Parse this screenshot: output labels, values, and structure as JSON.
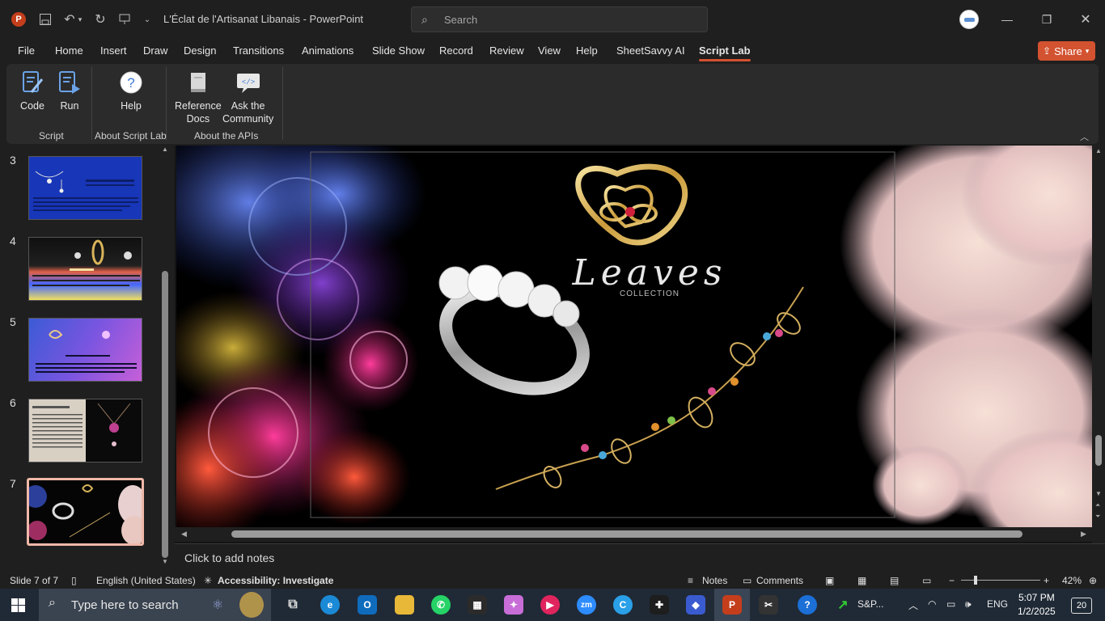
{
  "titlebar": {
    "doc_title": "L'Éclat de l'Artisanat Libanais  -  PowerPoint",
    "search_placeholder": "Search"
  },
  "tabs": [
    "File",
    "Home",
    "Insert",
    "Draw",
    "Design",
    "Transitions",
    "Animations",
    "Slide Show",
    "Record",
    "Review",
    "View",
    "Help",
    "SheetSavvy AI",
    "Script Lab"
  ],
  "active_tab": "Script Lab",
  "share_label": "Share",
  "ribbon": {
    "buttons": {
      "code": "Code",
      "run": "Run",
      "help": "Help",
      "ref_docs_1": "Reference",
      "ref_docs_2": "Docs",
      "ask_1": "Ask the",
      "ask_2": "Community"
    },
    "groups": {
      "script": "Script",
      "about_script_lab": "About Script Lab",
      "about_apis": "About the APIs"
    }
  },
  "thumbnails": [
    {
      "num": "3"
    },
    {
      "num": "4"
    },
    {
      "num": "5"
    },
    {
      "num": "6"
    },
    {
      "num": "7",
      "selected": true
    }
  ],
  "slide": {
    "logo_text": "Leaves",
    "logo_sub": "COLLECTION"
  },
  "notes_placeholder": "Click to add notes",
  "statusbar": {
    "slide_counter": "Slide 7 of 7",
    "language": "English (United States)",
    "accessibility": "Accessibility: Investigate",
    "notes": "Notes",
    "comments": "Comments",
    "zoom": "42%"
  },
  "taskbar": {
    "search_placeholder": "Type here to search",
    "sp_label": "S&P...",
    "language": "ENG",
    "time": "5:07 PM",
    "date": "1/2/2025",
    "notification_count": "20"
  },
  "colors": {
    "accent": "#d35230",
    "thumb_selected": "#f0b8a8"
  }
}
